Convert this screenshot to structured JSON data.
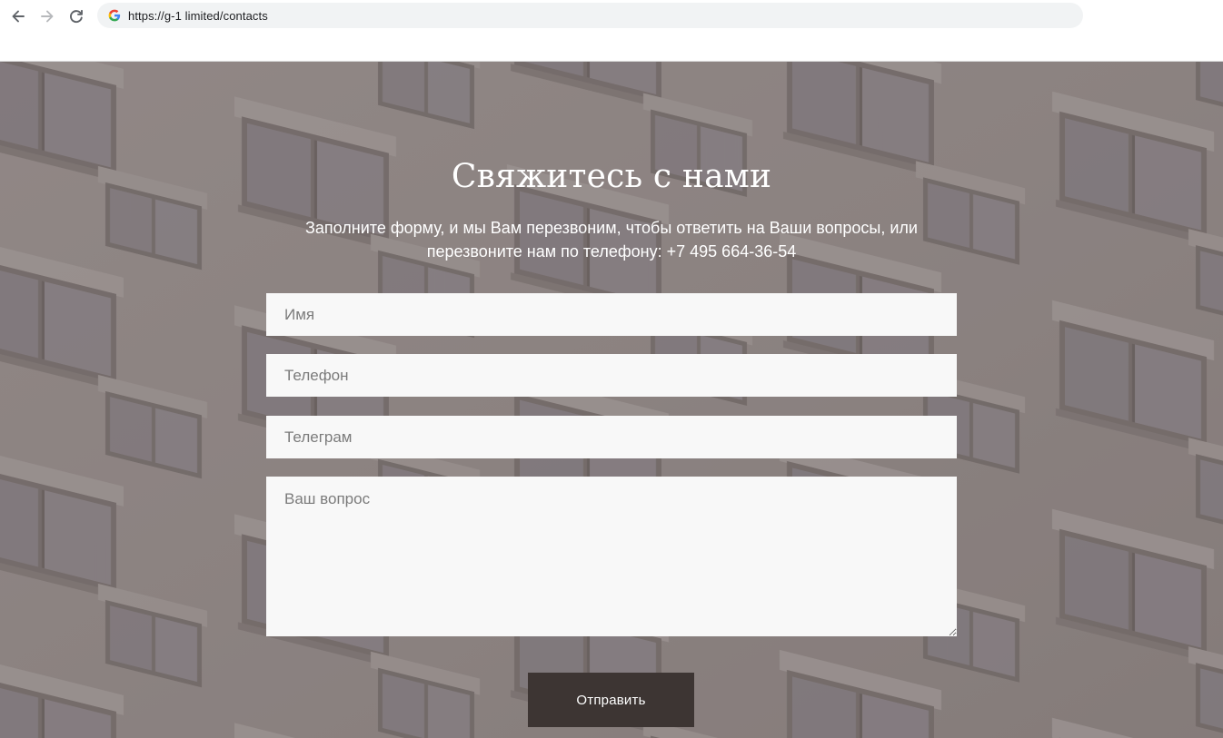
{
  "browser": {
    "url": "https://g-1 limited/contacts",
    "back_icon": "arrow-left-icon",
    "forward_icon": "arrow-right-icon",
    "reload_icon": "reload-icon",
    "site_icon": "google-icon"
  },
  "contact": {
    "title": "Свяжитесь с нами",
    "subtitle": "Заполните форму, и мы Вам перезвоним, чтобы ответить на Ваши вопросы, или перезвоните нам по телефону: +7 495 664-36-54",
    "fields": {
      "name_placeholder": "Имя",
      "phone_placeholder": "Телефон",
      "telegram_placeholder": "Телеграм",
      "question_placeholder": "Ваш вопрос"
    },
    "submit_label": "Отправить"
  },
  "colors": {
    "button_bg": "#3d3533",
    "field_bg": "#f8f8f8",
    "overlay": "#8f8685",
    "text_on_overlay": "#ffffff"
  }
}
